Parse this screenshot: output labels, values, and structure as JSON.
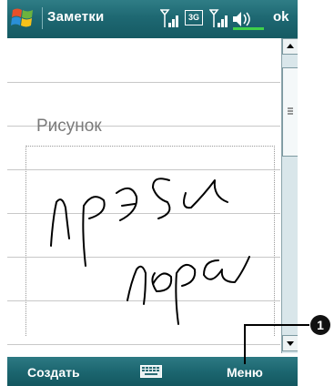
{
  "title_bar": {
    "app_title": "Заметки",
    "ok_label": "ok",
    "network_label": "3G"
  },
  "note": {
    "drawing_label": "Рисунок",
    "handwriting": [
      "пр ЭSи",
      "пора"
    ]
  },
  "command_bar": {
    "left_label": "Создать",
    "right_label": "Меню"
  },
  "callout": {
    "number": "1"
  },
  "colors": {
    "bar_teal": "#1e6872",
    "ink": "#000000",
    "ruled_line": "#c8c8c8"
  }
}
